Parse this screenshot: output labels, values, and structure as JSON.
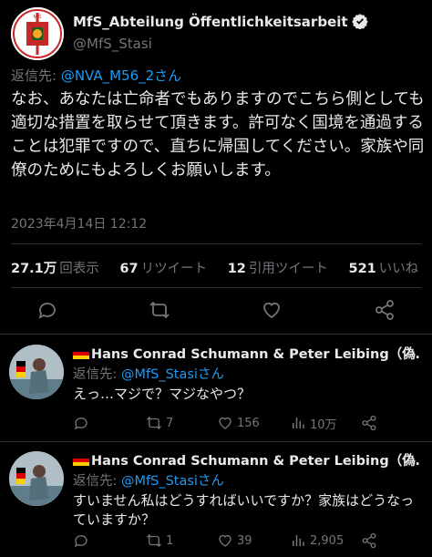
{
  "main_tweet": {
    "author_name": "MfS_Abteilung Öffentlichkeitsarbeit",
    "author_handle": "@MfS_Stasi",
    "reply_prefix": "返信先: ",
    "reply_mention": "@NVA_M56_2さん",
    "body": "なお、あなたは亡命者でもありますのでこちら側としても適切な措置を取らせて頂きます。許可なく国境を通過することは犯罪ですので、直ちに帰国してください。家族や同僚のためにもよろしくお願いします。",
    "timestamp": "2023年4月14日 12:12",
    "stats": {
      "views_num": "27.1万",
      "views_label": "回表示",
      "retweets_num": "67",
      "retweets_label": "リツイート",
      "quotes_num": "12",
      "quotes_label": "引用ツイート",
      "likes_num": "521",
      "likes_label": "いいね"
    },
    "actions": [
      "reply-icon",
      "retweet-icon",
      "like-icon",
      "share-icon"
    ]
  },
  "replies": [
    {
      "author_name": "Hans Conrad Schumann & Peter Leibing（偽…",
      "reply_prefix": "返信先: ",
      "reply_mention": "@MfS_Stasiさん",
      "text": "えっ…マジで？マジなやつ？",
      "reply_count": "",
      "retweet_count": "7",
      "like_count": "156",
      "view_count": "10万"
    },
    {
      "author_name": "Hans Conrad Schumann & Peter Leibing（偽…",
      "reply_prefix": "返信先: ",
      "reply_mention": "@MfS_Stasiさん",
      "text": "すいません私はどうすればいいですか？家族はどうなっていますか？",
      "reply_count": "",
      "retweet_count": "1",
      "like_count": "39",
      "view_count": "2,905"
    }
  ],
  "colors": {
    "background": "#000000",
    "text": "#e7e9ea",
    "muted": "#71767b",
    "link": "#1d9bf0",
    "divider": "#2f3336"
  }
}
